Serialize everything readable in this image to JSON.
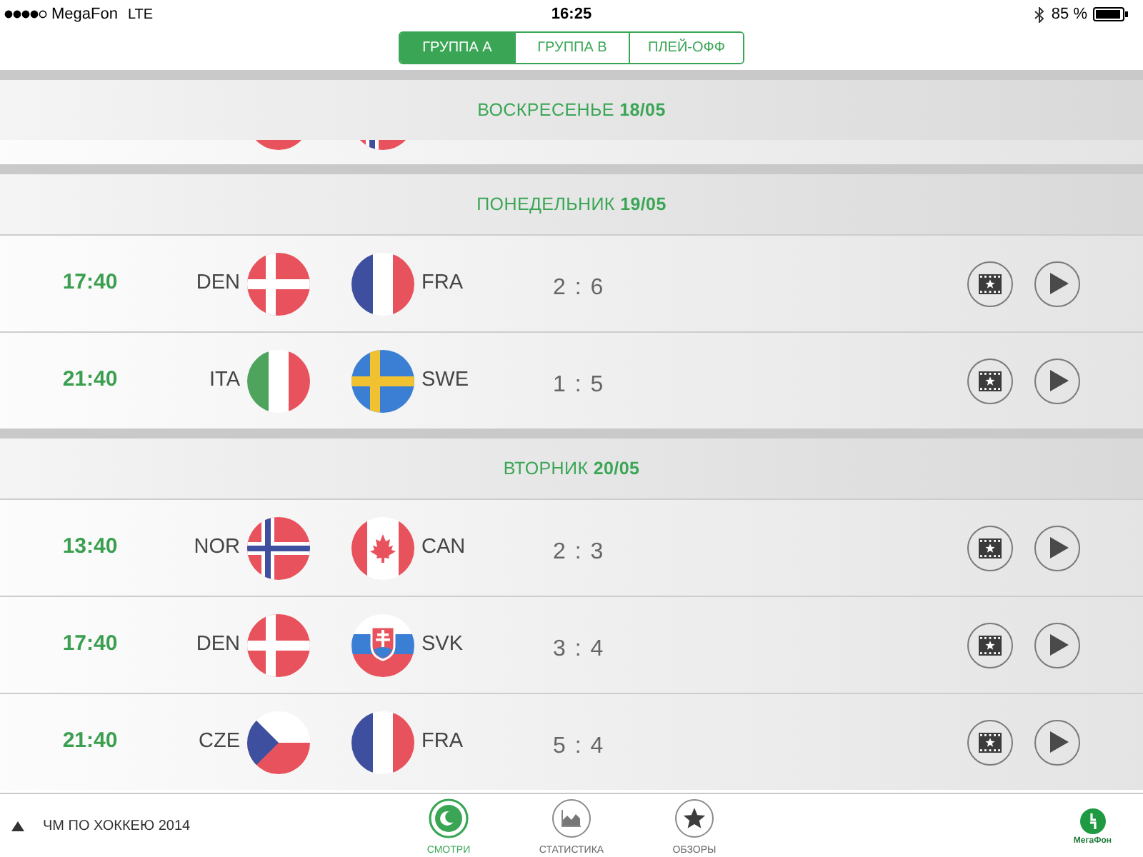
{
  "status_bar": {
    "carrier": "MegaFon",
    "network": "LTE",
    "time": "16:25",
    "battery": "85 %"
  },
  "segments": [
    {
      "label": "ГРУППА А",
      "selected": true
    },
    {
      "label": "ГРУППА В",
      "selected": false
    },
    {
      "label": "ПЛЕЙ-ОФФ",
      "selected": false
    }
  ],
  "days": [
    {
      "title": "ВОСКРЕСЕНЬЕ **18/05**",
      "partial_match": {
        "home": {
          "kind": "slovakia"
        },
        "away": {
          "kind": "norway"
        }
      }
    },
    {
      "title": "ПОНЕДЕЛЬНИК **19/05**",
      "matches": [
        {
          "time": "17:40",
          "home": {
            "code": "DEN",
            "kind": "denmark"
          },
          "away": {
            "code": "FRA",
            "kind": "france"
          },
          "score": "2 : 6"
        },
        {
          "time": "21:40",
          "home": {
            "code": "ITA",
            "kind": "italy"
          },
          "away": {
            "code": "SWE",
            "kind": "sweden"
          },
          "score": "1 : 5"
        }
      ]
    },
    {
      "title": "ВТОРНИК **20/05**",
      "matches": [
        {
          "time": "13:40",
          "home": {
            "code": "NOR",
            "kind": "norway"
          },
          "away": {
            "code": "CAN",
            "kind": "canada"
          },
          "score": "2 : 3"
        },
        {
          "time": "17:40",
          "home": {
            "code": "DEN",
            "kind": "denmark"
          },
          "away": {
            "code": "SVK",
            "kind": "slovakia"
          },
          "score": "3 : 4"
        },
        {
          "time": "21:40",
          "home": {
            "code": "CZE",
            "kind": "czechia"
          },
          "away": {
            "code": "FRA",
            "kind": "france"
          },
          "score": "5 : 4"
        }
      ]
    }
  ],
  "bottom_bar": {
    "title": "ЧМ ПО ХОККЕЮ 2014",
    "tabs": [
      {
        "label": "СМОТРИ",
        "kind": "watch",
        "selected": true
      },
      {
        "label": "СТАТИСТИКА",
        "kind": "stats",
        "selected": false
      },
      {
        "label": "ОБЗОРЫ",
        "kind": "reviews",
        "selected": false
      }
    ],
    "logo_text": "МегаФон"
  }
}
